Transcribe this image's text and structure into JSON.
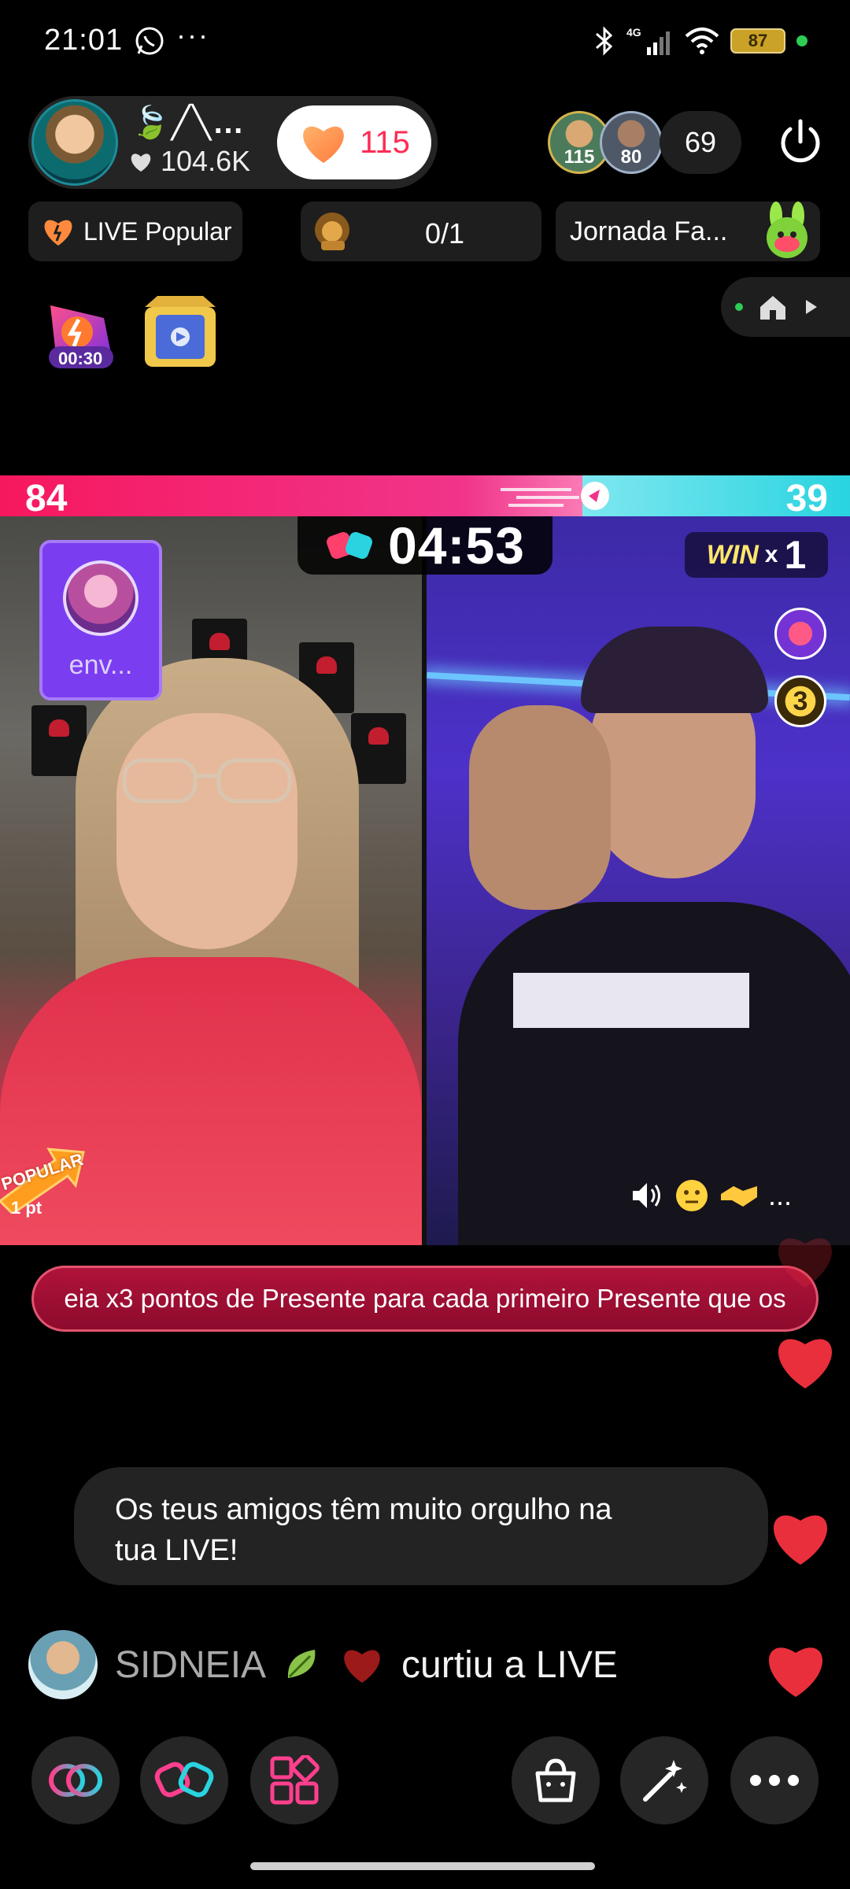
{
  "status_bar": {
    "time": "21:01",
    "more": "···",
    "network": "4G",
    "battery": "87"
  },
  "host": {
    "name": "🍃╱╲…",
    "likes": "104.6K",
    "follow_count": "115"
  },
  "viewers": {
    "avatar_1_badge": "115",
    "avatar_2_badge": "80",
    "count": "69"
  },
  "chips": {
    "popular": "LIVE Popular",
    "rank": "0/1",
    "journey": "Jornada Fa..."
  },
  "timer_badge": "00:30",
  "battle": {
    "score_left": "84",
    "score_right": "39",
    "timer": "04:53",
    "win_word": "WIN",
    "win_x": "x",
    "win_count": "1",
    "side_badge_number": "3",
    "sender_name": "env...",
    "popular_tag": "POPULAR",
    "popular_pts": "1 pt",
    "controls_more": "..."
  },
  "announcement": "eia x3 pontos de Presente para cada primeiro Presente que os",
  "chat": {
    "bubble_line1": "Os teus amigos têm muito orgulho na",
    "bubble_line2": "tua LIVE!",
    "user": "SIDNEIA",
    "message": "curtiu a LIVE"
  },
  "colors": {
    "accent_pink": "#fe2c55",
    "score_left": "#f6185e",
    "score_right": "#29d4e0",
    "announcement_bg": "#b0123a",
    "heart": "#ea2f3c"
  },
  "icons": {
    "status": [
      "whatsapp-icon",
      "bluetooth-icon",
      "signal-icon",
      "wifi-icon",
      "battery-icon"
    ],
    "bottom_bar": [
      "link-battle-icon",
      "battle-gloves-icon",
      "apps-grid-icon",
      "shopping-bag-icon",
      "magic-wand-icon",
      "more-icon"
    ]
  }
}
